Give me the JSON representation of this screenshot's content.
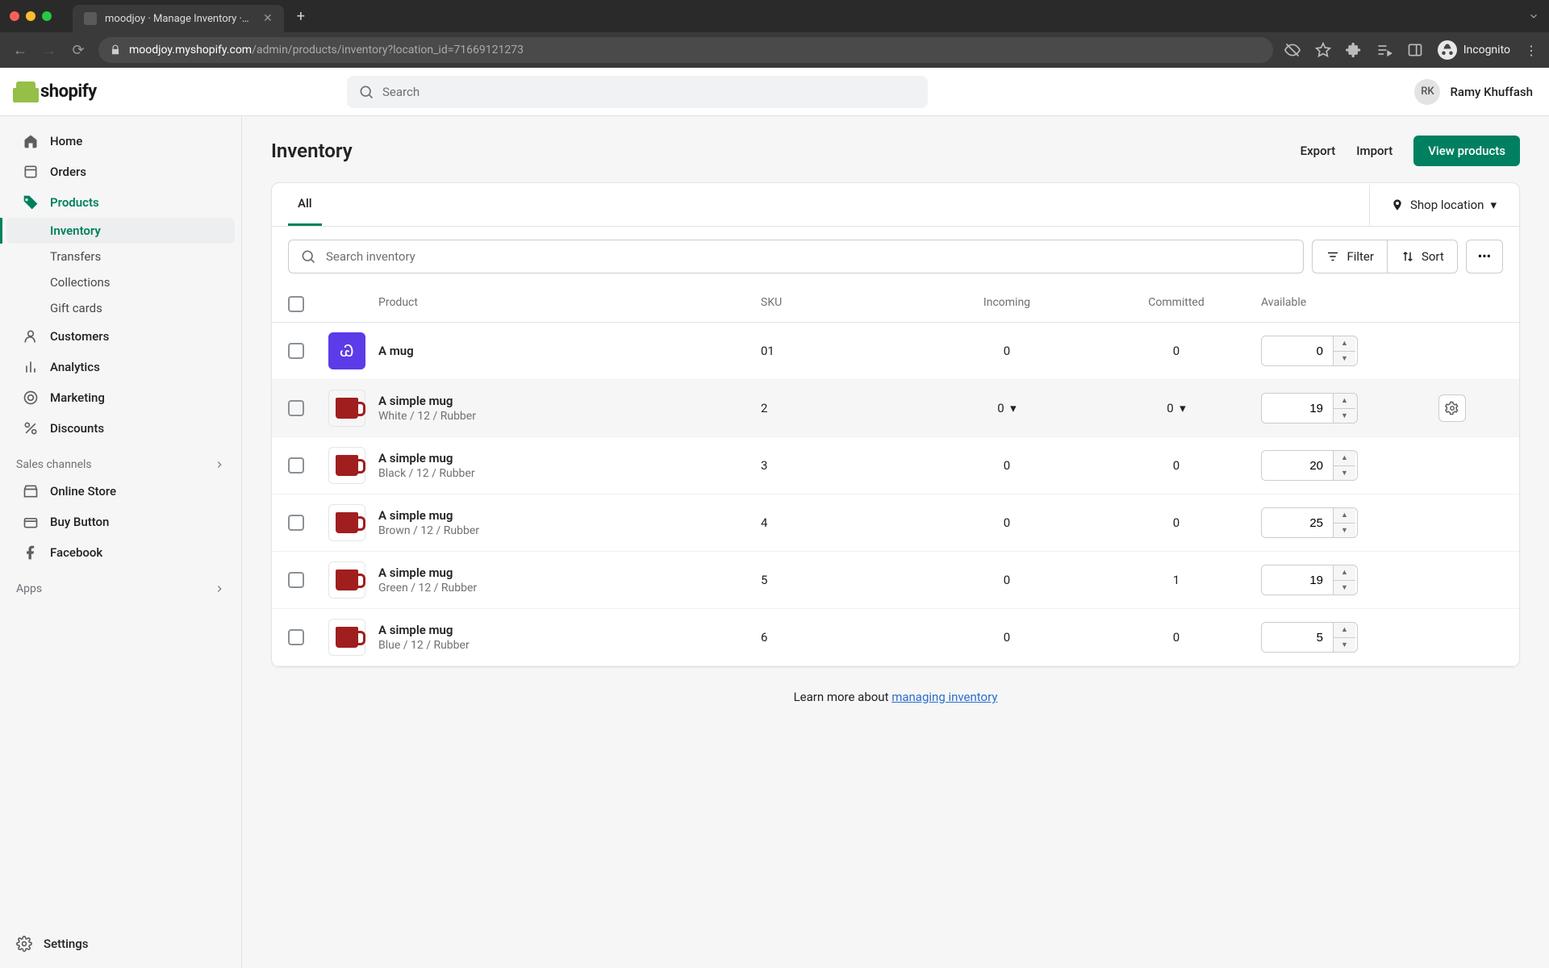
{
  "browser": {
    "tab_title": "moodjoy · Manage Inventory · S",
    "url_host": "moodjoy.myshopify.com",
    "url_path": "/admin/products/inventory?location_id=71669121273",
    "incognito_label": "Incognito"
  },
  "header": {
    "brand": "shopify",
    "search_placeholder": "Search",
    "user_initials": "RK",
    "user_name": "Ramy Khuffash"
  },
  "sidebar": {
    "items": [
      {
        "label": "Home"
      },
      {
        "label": "Orders"
      },
      {
        "label": "Products",
        "active_parent": true
      },
      {
        "label": "Customers"
      },
      {
        "label": "Analytics"
      },
      {
        "label": "Marketing"
      },
      {
        "label": "Discounts"
      }
    ],
    "sub_items": [
      {
        "label": "Inventory",
        "active": true
      },
      {
        "label": "Transfers"
      },
      {
        "label": "Collections"
      },
      {
        "label": "Gift cards"
      }
    ],
    "sales_channels_label": "Sales channels",
    "channels": [
      {
        "label": "Online Store"
      },
      {
        "label": "Buy Button"
      },
      {
        "label": "Facebook"
      }
    ],
    "apps_label": "Apps",
    "settings_label": "Settings"
  },
  "page": {
    "title": "Inventory",
    "export_label": "Export",
    "import_label": "Import",
    "view_products_label": "View products",
    "tab_all": "All",
    "location_label": "Shop location",
    "search_placeholder": "Search inventory",
    "filter_label": "Filter",
    "sort_label": "Sort",
    "columns": {
      "product": "Product",
      "sku": "SKU",
      "incoming": "Incoming",
      "committed": "Committed",
      "available": "Available"
    },
    "rows": [
      {
        "name": "A mug",
        "variant": "",
        "sku": "01",
        "incoming": "0",
        "committed": "0",
        "available": "0",
        "thumb": "purple",
        "hover": false
      },
      {
        "name": "A simple mug",
        "variant": "White / 12 / Rubber",
        "sku": "2",
        "incoming": "0",
        "committed": "0",
        "available": "19",
        "thumb": "mug",
        "hover": true,
        "dropdown": true
      },
      {
        "name": "A simple mug",
        "variant": "Black / 12 / Rubber",
        "sku": "3",
        "incoming": "0",
        "committed": "0",
        "available": "20",
        "thumb": "mug",
        "hover": false
      },
      {
        "name": "A simple mug",
        "variant": "Brown / 12 / Rubber",
        "sku": "4",
        "incoming": "0",
        "committed": "0",
        "available": "25",
        "thumb": "mug",
        "hover": false
      },
      {
        "name": "A simple mug",
        "variant": "Green / 12 / Rubber",
        "sku": "5",
        "incoming": "0",
        "committed": "1",
        "available": "19",
        "thumb": "mug",
        "hover": false
      },
      {
        "name": "A simple mug",
        "variant": "Blue / 12 / Rubber",
        "sku": "6",
        "incoming": "0",
        "committed": "0",
        "available": "5",
        "thumb": "mug",
        "hover": false
      }
    ],
    "learn_more_prefix": "Learn more about ",
    "learn_more_link": "managing inventory"
  }
}
